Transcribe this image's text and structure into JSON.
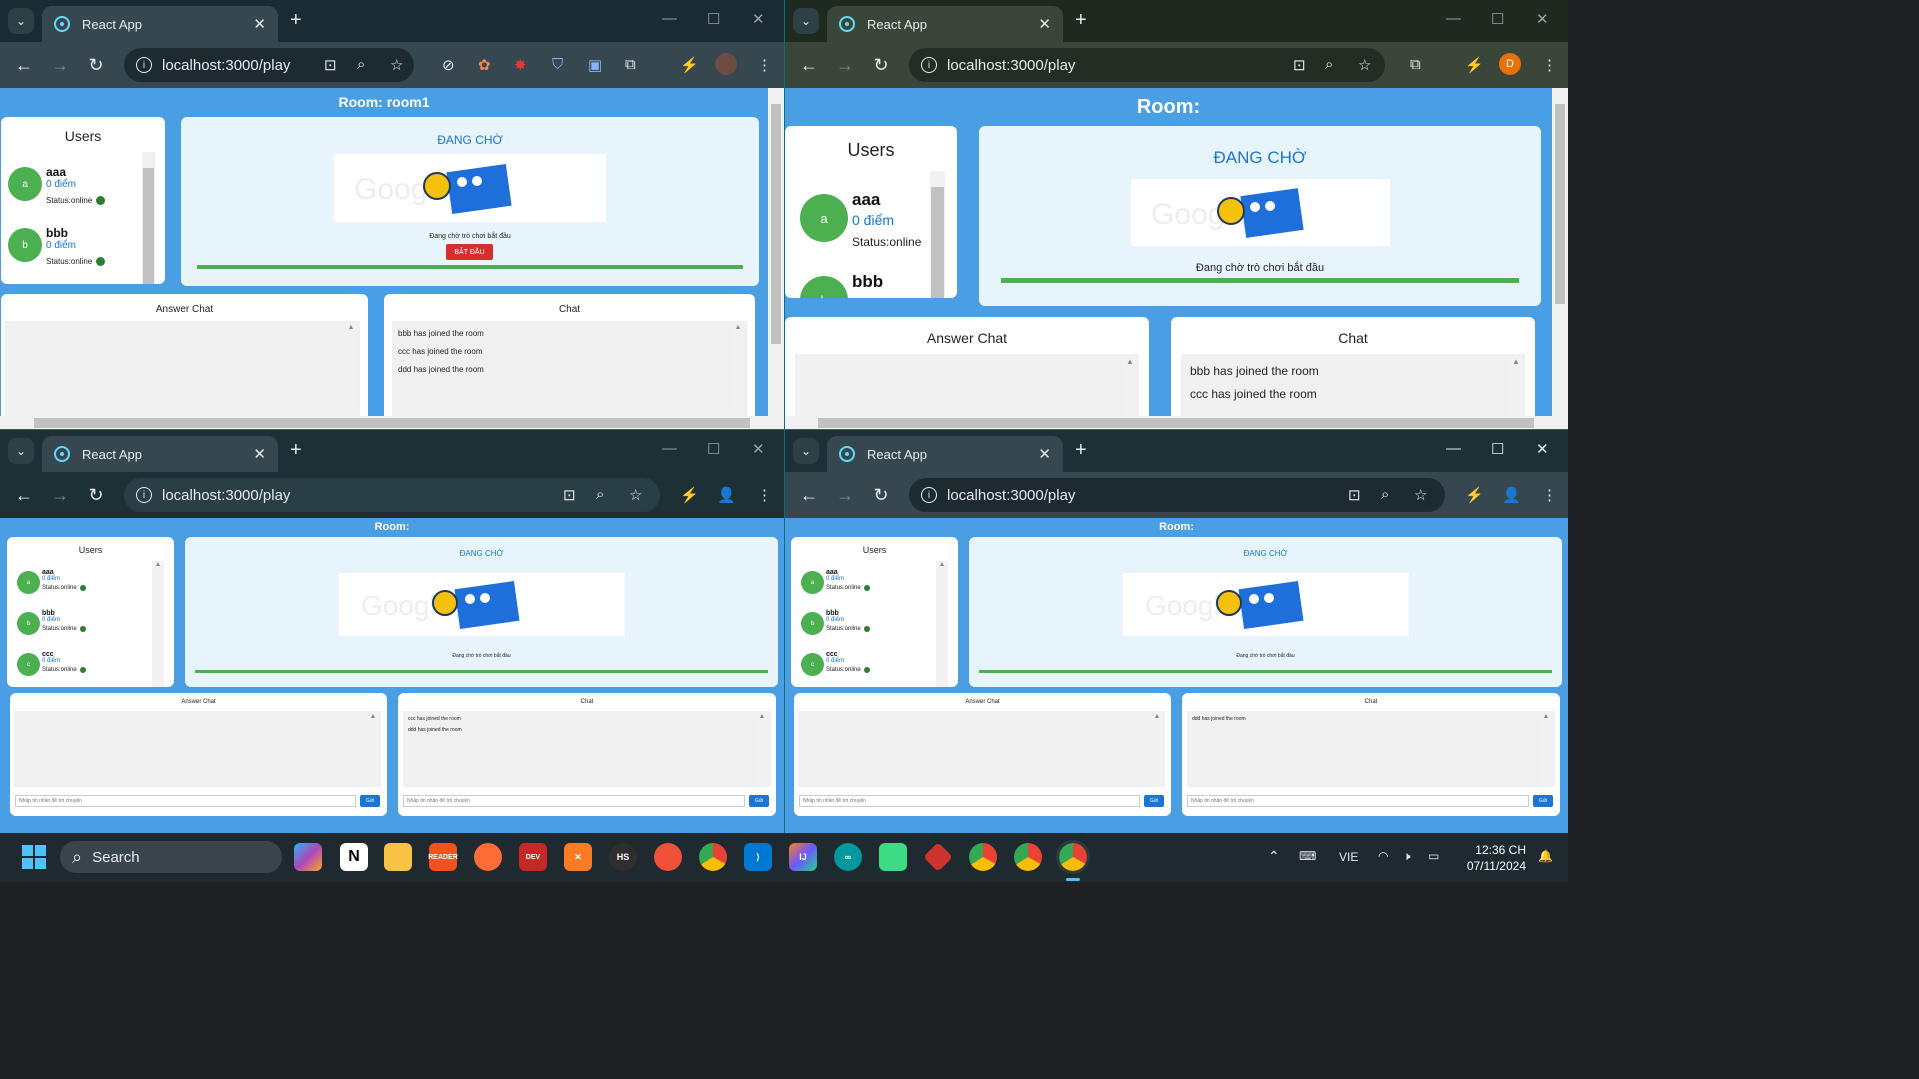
{
  "browser": {
    "tab_title": "React App",
    "url": "localhost:3000/play"
  },
  "windows": [
    {
      "room_label": "Room: room1",
      "users_header": "Users",
      "users": [
        {
          "initial": "a",
          "name": "aaa",
          "points": "0 điểm",
          "status": "Status:online"
        },
        {
          "initial": "b",
          "name": "bbb",
          "points": "0 điểm",
          "status": "Status:online"
        }
      ],
      "waiting_title": "ĐANG CHỜ",
      "waiting_text": "Đang chờ trò chơi bắt đầu",
      "start_button": "BẮT ĐẦU",
      "answer_chat_header": "Answer Chat",
      "chat_header": "Chat",
      "chat_messages": [
        "bbb has joined the room",
        "ccc has joined the room",
        "ddd has joined the room"
      ]
    },
    {
      "room_label": "Room:",
      "users_header": "Users",
      "users": [
        {
          "initial": "a",
          "name": "aaa",
          "points": "0 điểm",
          "status": "Status:online"
        },
        {
          "initial": "b",
          "name": "bbb",
          "points": "",
          "status": ""
        }
      ],
      "waiting_title": "ĐANG CHỜ",
      "waiting_text": "Đang chờ trò chơi bắt đầu",
      "answer_chat_header": "Answer Chat",
      "chat_header": "Chat",
      "chat_messages": [
        "bbb has joined the room",
        "ccc has joined the room"
      ],
      "profile_initial": "D"
    },
    {
      "room_label": "Room:",
      "users_header": "Users",
      "users": [
        {
          "initial": "a",
          "name": "aaa",
          "points": "0 điểm",
          "status": "Status:online"
        },
        {
          "initial": "b",
          "name": "bbb",
          "points": "0 điểm",
          "status": "Status:online"
        },
        {
          "initial": "c",
          "name": "ccc",
          "points": "0 điểm",
          "status": "Status:online"
        }
      ],
      "waiting_title": "ĐANG CHỜ",
      "waiting_text": "Đang chờ trò chơi bắt đầu",
      "answer_chat_header": "Answer Chat",
      "chat_header": "Chat",
      "chat_messages": [
        "ccc has joined the room",
        "ddd has joined the room"
      ],
      "input_placeholder": "Nhập tin nhắn để trò chuyện",
      "send_label": "Gửi"
    },
    {
      "room_label": "Room:",
      "users_header": "Users",
      "users": [
        {
          "initial": "a",
          "name": "aaa",
          "points": "0 điểm",
          "status": "Status:online"
        },
        {
          "initial": "b",
          "name": "bbb",
          "points": "0 điểm",
          "status": "Status:online"
        },
        {
          "initial": "c",
          "name": "ccc",
          "points": "0 điểm",
          "status": "Status:online"
        }
      ],
      "waiting_title": "ĐANG CHỜ",
      "waiting_text": "Đang chờ trò chơi bắt đầu",
      "answer_chat_header": "Answer Chat",
      "chat_header": "Chat",
      "chat_messages": [
        "ddd has joined the room"
      ],
      "input_placeholder": "Nhập tin nhắn để trò chuyện",
      "send_label": "Gửi"
    }
  ],
  "taskbar": {
    "search_label": "Search",
    "language": "VIE",
    "time": "12:36 CH",
    "date": "07/11/2024",
    "apps": [
      "copilot",
      "notion",
      "file-explorer",
      "reader",
      "postman",
      "dev-c++",
      "xampp",
      "hs",
      "swift",
      "chrome",
      "vscode",
      "jetbrains",
      "arduino",
      "android-studio",
      "ruby",
      "chrome-profile",
      "chrome",
      "chrome-active"
    ]
  }
}
